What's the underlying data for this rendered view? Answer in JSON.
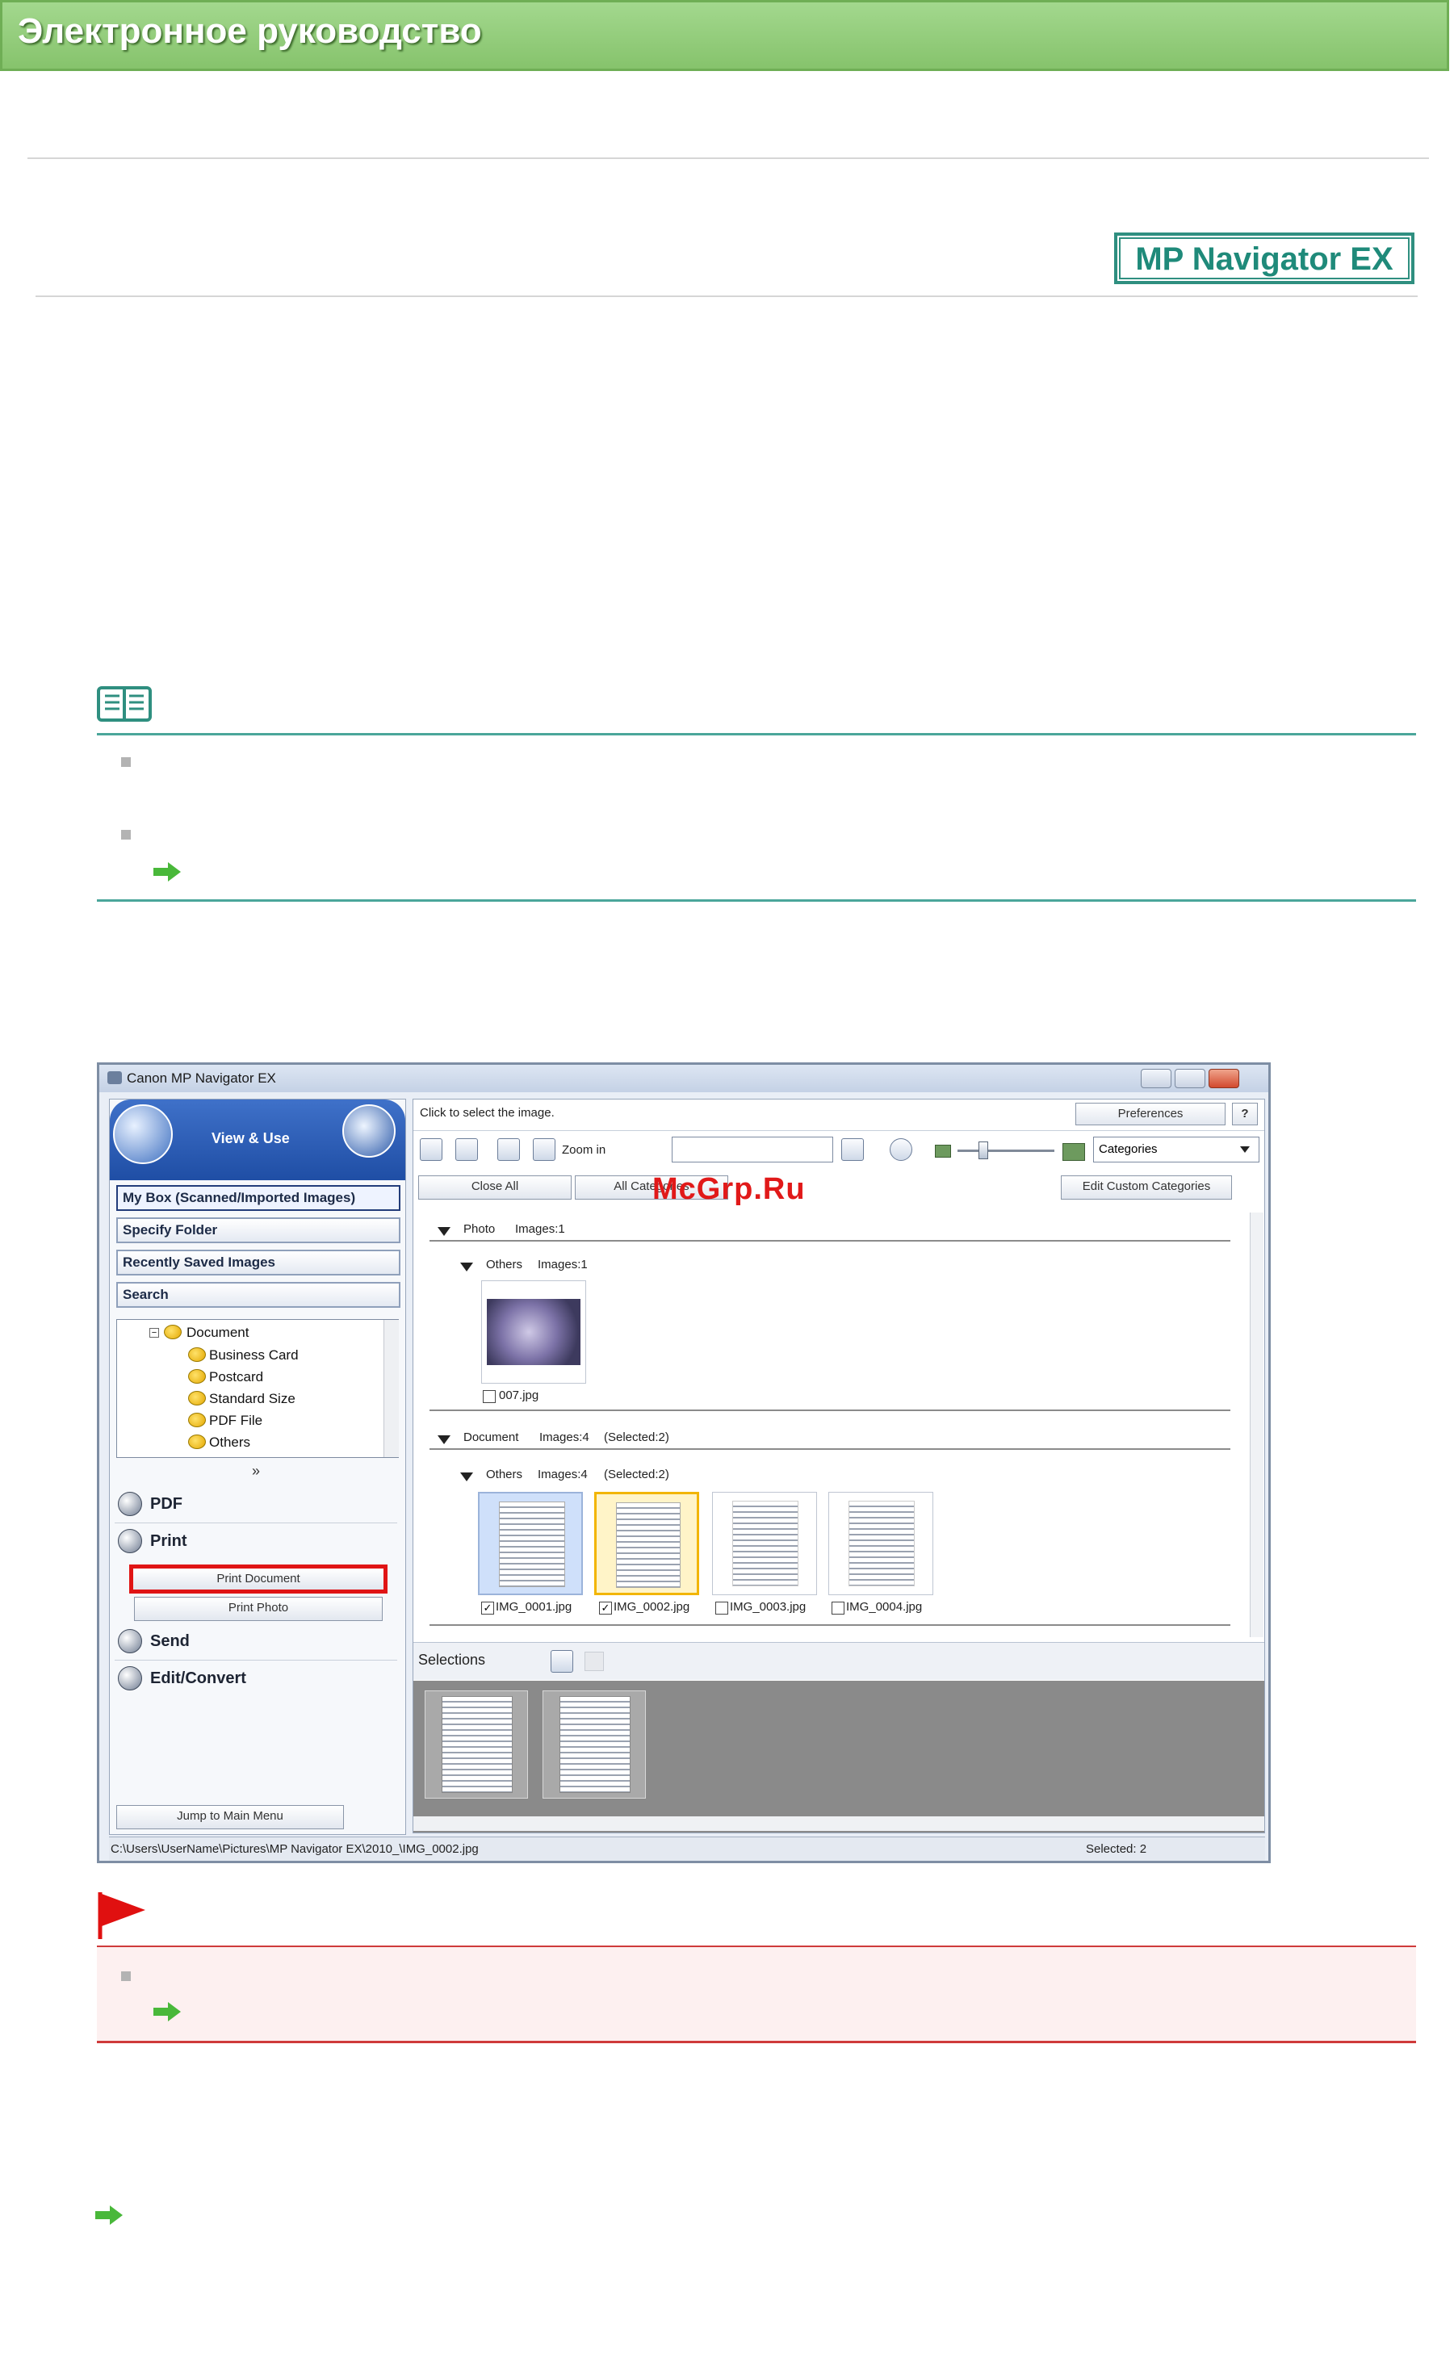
{
  "header": {
    "title": "Электронное руководство"
  },
  "badge": {
    "label": "MP Navigator EX"
  },
  "screenshot": {
    "window_title": "Canon MP Navigator EX",
    "left_panel": {
      "mode": "View & Use",
      "tabs": [
        "My Box (Scanned/Imported Images)",
        "Specify Folder",
        "Recently Saved Images",
        "Search"
      ],
      "tree": {
        "root": "Document",
        "children": [
          "Business Card",
          "Postcard",
          "Standard Size",
          "PDF File",
          "Others"
        ]
      },
      "menu": {
        "pdf": "PDF",
        "print": "Print",
        "print_document": "Print Document",
        "print_photo": "Print Photo",
        "send": "Send",
        "edit_convert": "Edit/Convert"
      },
      "jump": "Jump to Main Menu"
    },
    "main": {
      "hint": "Click to select the image.",
      "preferences": "Preferences",
      "help": "?",
      "zoom_in": "Zoom in",
      "categories": "Categories",
      "close_all": "Close All",
      "all_categories": "All Categories",
      "edit_custom": "Edit Custom Categories",
      "photo_group": {
        "label": "Photo",
        "count": "Images:1"
      },
      "photo_others": {
        "label": "Others",
        "count": "Images:1"
      },
      "photo_file": "007.jpg",
      "doc_group": {
        "label": "Document",
        "count": "Images:4",
        "selected": "(Selected:2)"
      },
      "doc_others": {
        "label": "Others",
        "count": "Images:4",
        "selected": "(Selected:2)"
      },
      "doc_files": [
        {
          "name": "IMG_0001.jpg",
          "checked": "✓"
        },
        {
          "name": "IMG_0002.jpg",
          "checked": "✓"
        },
        {
          "name": "IMG_0003.jpg",
          "checked": ""
        },
        {
          "name": "IMG_0004.jpg",
          "checked": ""
        }
      ],
      "selections": "Selections"
    },
    "status": {
      "path": "C:\\Users\\UserName\\Pictures\\MP Navigator EX\\2010_\\IMG_0002.jpg",
      "selected": "Selected: 2"
    }
  },
  "watermark": "McGrp.Ru",
  "colors": {
    "header_green": "#86c36c",
    "teal": "#2f8f80",
    "note_line": "#4aa69a",
    "caution_red": "#cf3a3a",
    "caution_bg": "#fdf0f0",
    "arrow_green": "#49b83a"
  }
}
